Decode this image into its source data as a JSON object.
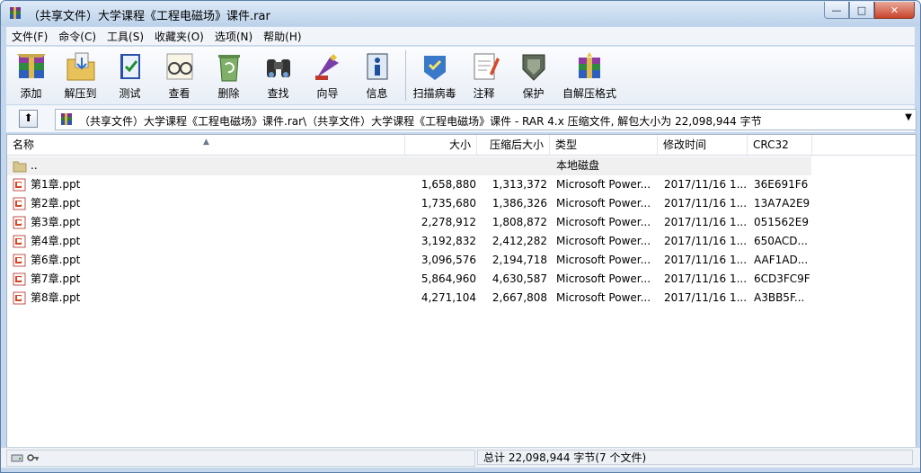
{
  "window": {
    "title": "（共享文件）大学课程《工程电磁场》课件.rar",
    "buttons": {
      "minimize": "—",
      "maximize": "□",
      "close": "✕"
    }
  },
  "menu": [
    "文件(F)",
    "命令(C)",
    "工具(S)",
    "收藏夹(O)",
    "选项(N)",
    "帮助(H)"
  ],
  "toolbar": {
    "items": [
      {
        "label": "添加",
        "icon": "archive-add-icon"
      },
      {
        "label": "解压到",
        "icon": "extract-folder-icon"
      },
      {
        "label": "测试",
        "icon": "test-book-icon"
      },
      {
        "label": "查看",
        "icon": "view-glasses-icon"
      },
      {
        "label": "删除",
        "icon": "delete-recycle-icon"
      },
      {
        "label": "查找",
        "icon": "find-binoculars-icon"
      },
      {
        "label": "向导",
        "icon": "wizard-icon"
      },
      {
        "label": "信息",
        "icon": "info-icon"
      },
      {
        "label": "扫描病毒",
        "icon": "virus-scan-icon"
      },
      {
        "label": "注释",
        "icon": "comment-icon"
      },
      {
        "label": "保护",
        "icon": "protect-shield-icon"
      },
      {
        "label": "自解压格式",
        "icon": "sfx-icon"
      }
    ]
  },
  "address": {
    "path": "（共享文件）大学课程《工程电磁场》课件.rar\\（共享文件）大学课程《工程电磁场》课件 - RAR 4.x 压缩文件, 解包大小为 22,098,944 字节"
  },
  "columns": {
    "name": "名称",
    "size": "大小",
    "packed": "压缩后大小",
    "type": "类型",
    "modified": "修改时间",
    "crc": "CRC32"
  },
  "up_row": {
    "name": "..",
    "type": "本地磁盘"
  },
  "files": [
    {
      "name": "第1章.ppt",
      "size": "1,658,880",
      "packed": "1,313,372",
      "type": "Microsoft Power...",
      "modified": "2017/11/16 1...",
      "crc": "36E691F6"
    },
    {
      "name": "第2章.ppt",
      "size": "1,735,680",
      "packed": "1,386,326",
      "type": "Microsoft Power...",
      "modified": "2017/11/16 1...",
      "crc": "13A7A2E9"
    },
    {
      "name": "第3章.ppt",
      "size": "2,278,912",
      "packed": "1,808,872",
      "type": "Microsoft Power...",
      "modified": "2017/11/16 1...",
      "crc": "051562E9"
    },
    {
      "name": "第4章.ppt",
      "size": "3,192,832",
      "packed": "2,412,282",
      "type": "Microsoft Power...",
      "modified": "2017/11/16 1...",
      "crc": "650ACD..."
    },
    {
      "name": "第6章.ppt",
      "size": "3,096,576",
      "packed": "2,194,718",
      "type": "Microsoft Power...",
      "modified": "2017/11/16 1...",
      "crc": "AAF1AD..."
    },
    {
      "name": "第7章.ppt",
      "size": "5,864,960",
      "packed": "4,630,587",
      "type": "Microsoft Power...",
      "modified": "2017/11/16 1...",
      "crc": "6CD3FC9F"
    },
    {
      "name": "第8章.ppt",
      "size": "4,271,104",
      "packed": "2,667,808",
      "type": "Microsoft Power...",
      "modified": "2017/11/16 1...",
      "crc": "A3BB5F..."
    }
  ],
  "status": {
    "summary": "总计 22,098,944 字节(7 个文件)"
  }
}
